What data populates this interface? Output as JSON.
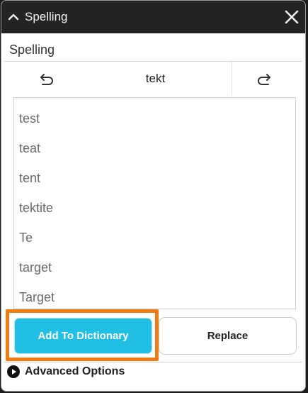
{
  "titlebar": {
    "title": "Spelling",
    "collapse_icon": "chevron-up-icon",
    "close_icon": "close-icon"
  },
  "section": {
    "label": "Spelling"
  },
  "navigator": {
    "current_word": "tekt",
    "undo_icon": "undo-icon",
    "redo_icon": "redo-icon"
  },
  "suggestions": [
    "test",
    "teat",
    "tent",
    "tektite",
    "Te",
    "target",
    "Target"
  ],
  "buttons": {
    "add_to_dictionary": "Add To Dictionary",
    "replace": "Replace"
  },
  "advanced": {
    "label": "Advanced Options",
    "icon": "play-circle-icon"
  },
  "colors": {
    "accent": "#22bfe4",
    "highlight": "#f07b12",
    "titlebar": "#232323"
  }
}
